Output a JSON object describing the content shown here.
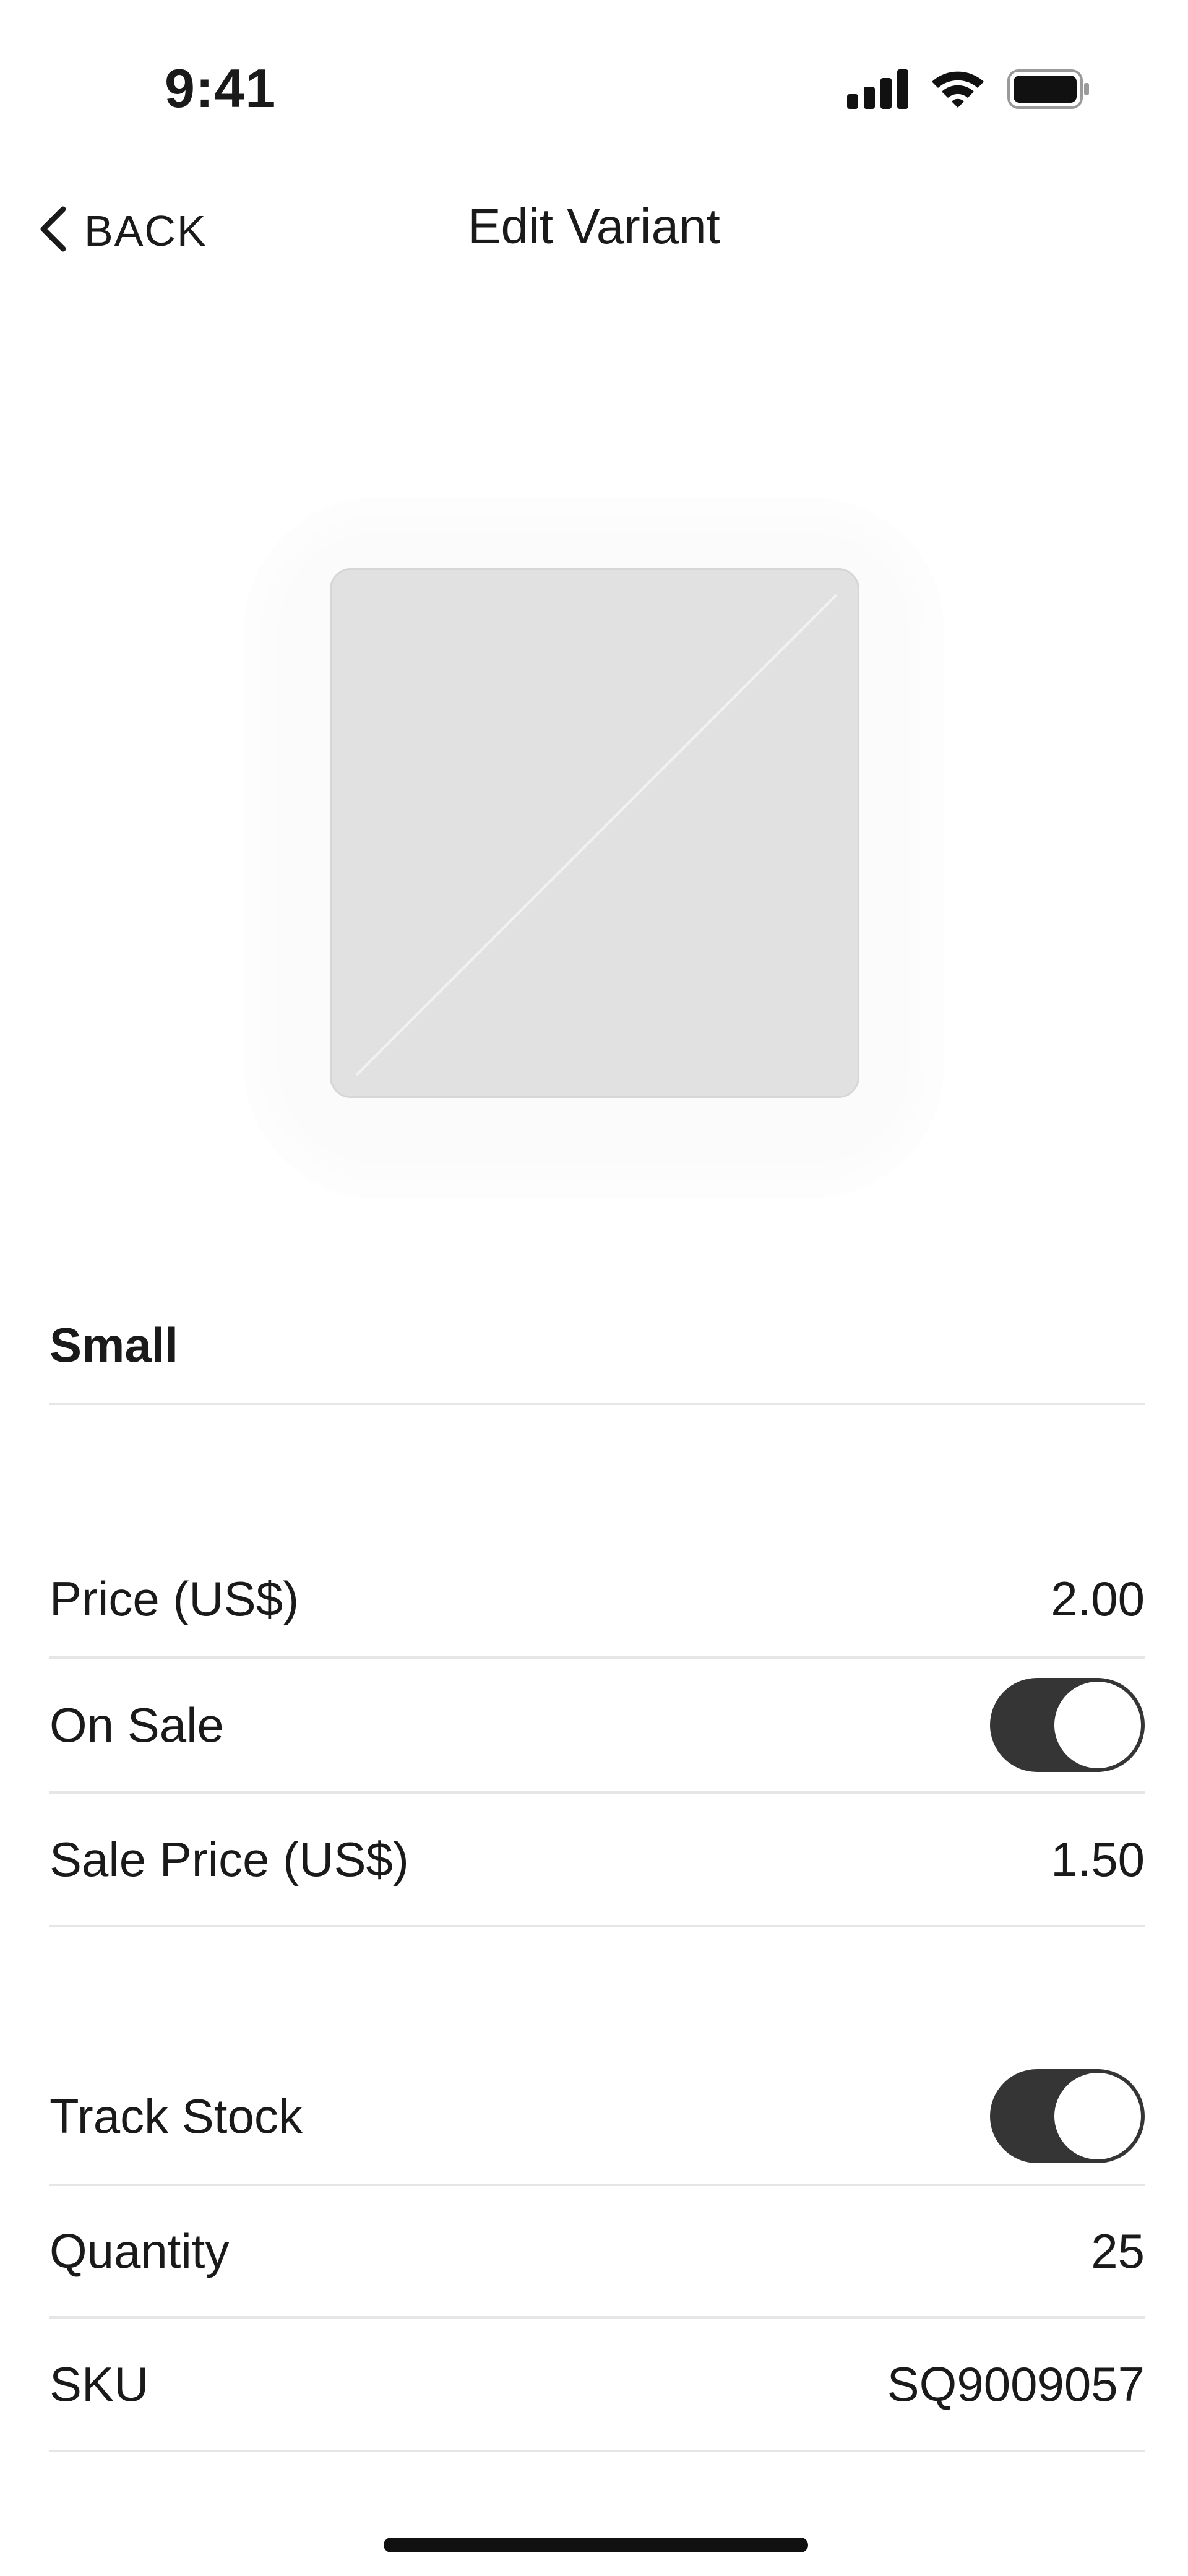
{
  "status_bar": {
    "time": "9:41"
  },
  "nav": {
    "back_label": "BACK",
    "title": "Edit Variant"
  },
  "variant": {
    "name": "Small"
  },
  "pricing": {
    "price_label": "Price (US$)",
    "price_value": "2.00",
    "on_sale_label": "On Sale",
    "on_sale_enabled": true,
    "sale_price_label": "Sale Price (US$)",
    "sale_price_value": "1.50"
  },
  "inventory": {
    "track_stock_label": "Track Stock",
    "track_stock_enabled": true,
    "quantity_label": "Quantity",
    "quantity_value": "25",
    "sku_label": "SKU",
    "sku_value": "SQ9009057"
  },
  "icons": {
    "back": "chevron-left-icon",
    "signal": "cellular-signal-icon",
    "wifi": "wifi-icon",
    "battery": "battery-icon"
  },
  "colors": {
    "toggle_on": "#353535",
    "placeholder": "#e1e1e1",
    "divider": "#e6e6e6"
  }
}
